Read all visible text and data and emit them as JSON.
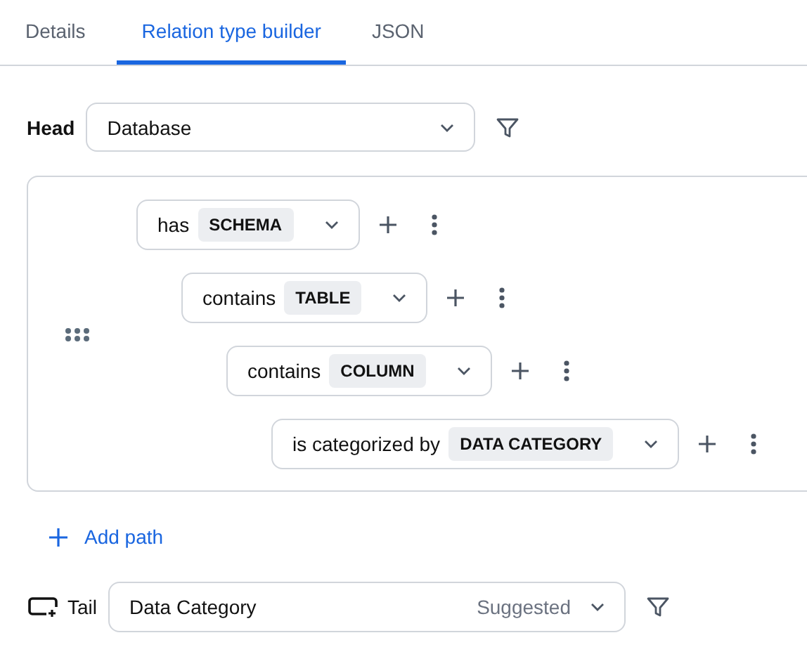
{
  "tabs": [
    {
      "label": "Details",
      "selected": false
    },
    {
      "label": "Relation type builder",
      "selected": true
    },
    {
      "label": "JSON",
      "selected": false
    }
  ],
  "head": {
    "label": "Head",
    "value": "Database"
  },
  "path": [
    {
      "verb": "has",
      "type": "SCHEMA",
      "children": [
        {
          "verb": "contains",
          "type": "TABLE",
          "children": [
            {
              "verb": "contains",
              "type": "COLUMN",
              "children": [
                {
                  "verb": "is categorized by",
                  "type": "DATA CATEGORY"
                }
              ]
            }
          ]
        }
      ]
    }
  ],
  "add_path": "Add path",
  "tail": {
    "label": "Tail",
    "value": "Data Category",
    "hint": "Suggested"
  }
}
